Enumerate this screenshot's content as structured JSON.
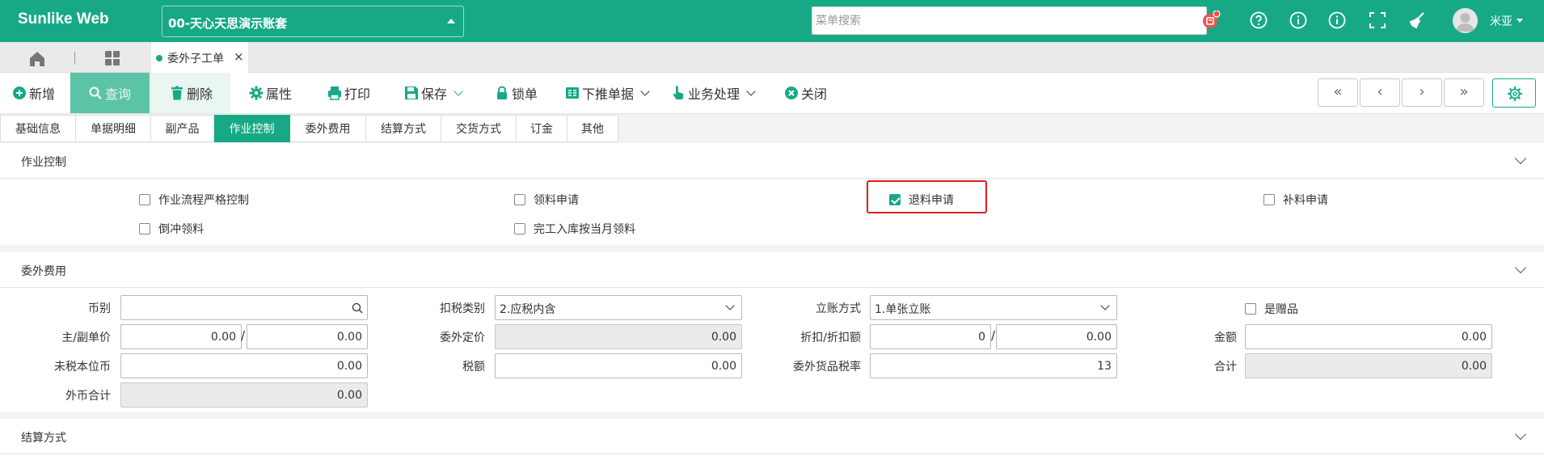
{
  "header": {
    "brand": "Sunlike Web",
    "account": "00-天心天思演示账套",
    "search_placeholder": "菜单搜索",
    "user_name": "米亚",
    "icons": [
      "notification-icon",
      "help-icon",
      "info-icon",
      "about-icon",
      "fullscreen-icon",
      "clean-icon"
    ],
    "accent_color": "#17a986",
    "badge_color": "#e8554e"
  },
  "tabs": {
    "home_icon": "home-icon",
    "grid_icon": "grid-icon",
    "doc_tab_label": "委外子工单",
    "close_glyph": "×"
  },
  "toolbar": {
    "new_label": "新增",
    "query_label": "查询",
    "delete_label": "删除",
    "properties_label": "属性",
    "print_label": "打印",
    "save_label": "保存",
    "lock_label": "锁单",
    "push_label": "下推单据",
    "business_label": "业务处理",
    "close_label": "关闭",
    "nav": [
      "«",
      "‹",
      "›",
      "»"
    ]
  },
  "subtabs": [
    "基础信息",
    "单据明细",
    "副产品",
    "作业控制",
    "委外费用",
    "结算方式",
    "交货方式",
    "订金",
    "其他"
  ],
  "active_subtab": "作业控制",
  "work_control": {
    "title": "作业控制",
    "strict_flow": {
      "label": "作业流程严格控制",
      "checked": false
    },
    "material_request": {
      "label": "领料申请",
      "checked": false
    },
    "return_request": {
      "label": "退料申请",
      "checked": true
    },
    "supplement_request": {
      "label": "补料申请",
      "checked": false
    },
    "backflush": {
      "label": "倒冲领料",
      "checked": false
    },
    "monthly_issue": {
      "label": "完工入库按当月领料",
      "checked": false
    }
  },
  "outsourcing_fees": {
    "title": "委外费用",
    "currency_label": "币别",
    "currency_value": "",
    "tax_type_label": "扣税类别",
    "tax_type_value": "2.应税内含",
    "account_method_label": "立账方式",
    "account_method_value": "1.单张立账",
    "gift_label": "是赠品",
    "gift_checked": false,
    "unit_price_label": "主/副单价",
    "unit_price_main": "0.00",
    "unit_price_sub": "0.00",
    "fixed_price_label": "委外定价",
    "fixed_price_value": "0.00",
    "discount_label": "折扣/折扣额",
    "discount_rate": "0",
    "discount_amount": "0.00",
    "amount_label": "金额",
    "amount_value": "0.00",
    "untaxed_local_label": "未税本位币",
    "untaxed_local_value": "0.00",
    "tax_label": "税额",
    "tax_value": "0.00",
    "goods_tax_rate_label": "委外货品税率",
    "goods_tax_rate_value": "13",
    "total_label": "合计",
    "total_value": "0.00",
    "foreign_total_label": "外币合计",
    "foreign_total_value": "0.00"
  },
  "settlement": {
    "title": "结算方式"
  }
}
